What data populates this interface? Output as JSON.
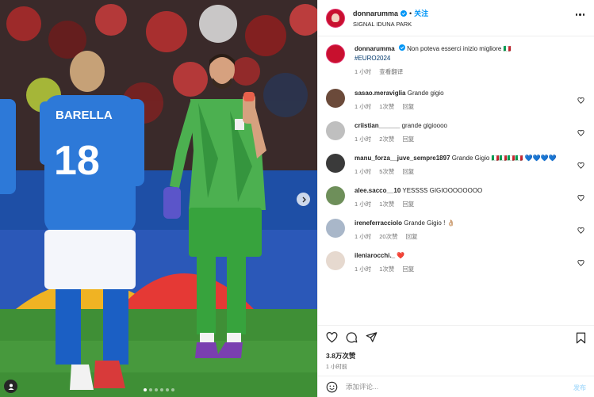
{
  "colors": {
    "accent": "#0095f6",
    "text": "#262626",
    "muted": "#737373",
    "hashtag": "#00376b",
    "heart": "#ed4956"
  },
  "header": {
    "username": "donnarumma",
    "separator": "•",
    "follow_label": "关注",
    "location": "SIGNAL IDUNA PARK"
  },
  "media": {
    "jersey_name": "BARELLA",
    "jersey_number": "18",
    "slide_count": 6,
    "active_slide": 1
  },
  "caption": {
    "username": "donnarumma",
    "text": "Non poteva esserci inizio migliore 🇮🇹",
    "hashtag": "#EURO2024",
    "time": "1 小时",
    "translate": "查看翻译"
  },
  "comments": [
    {
      "username": "sasao.meraviglia",
      "text": "Grande gigio",
      "time": "1 小时",
      "likes": "1次赞",
      "reply": "回复"
    },
    {
      "username": "criistian______",
      "text": "grande gigioooo",
      "time": "1 小时",
      "likes": "2次赞",
      "reply": "回复"
    },
    {
      "username": "manu_forza__juve_sempre1897",
      "text": "Grande Gigio 🇮🇹🇮🇹🇮🇹🇮🇹 💙💙💙💙",
      "time": "1 小时",
      "likes": "5次赞",
      "reply": "回复"
    },
    {
      "username": "alee.sacco__10",
      "text": "YESSSS GIGIOOOOOOOO",
      "time": "1 小时",
      "likes": "1次赞",
      "reply": "回复"
    },
    {
      "username": "ireneferracciolo",
      "text": "Grande Gigio ! 👌🏼",
      "time": "1 小时",
      "likes": "20次赞",
      "reply": "回复"
    },
    {
      "username": "ileniarocchi._",
      "text": "❤️",
      "time": "1 小时",
      "likes": "1次赞",
      "reply": "回复"
    }
  ],
  "footer": {
    "likes": "3.8万次赞",
    "time": "1 小时前",
    "comment_placeholder": "添加评论...",
    "post_label": "发布"
  }
}
